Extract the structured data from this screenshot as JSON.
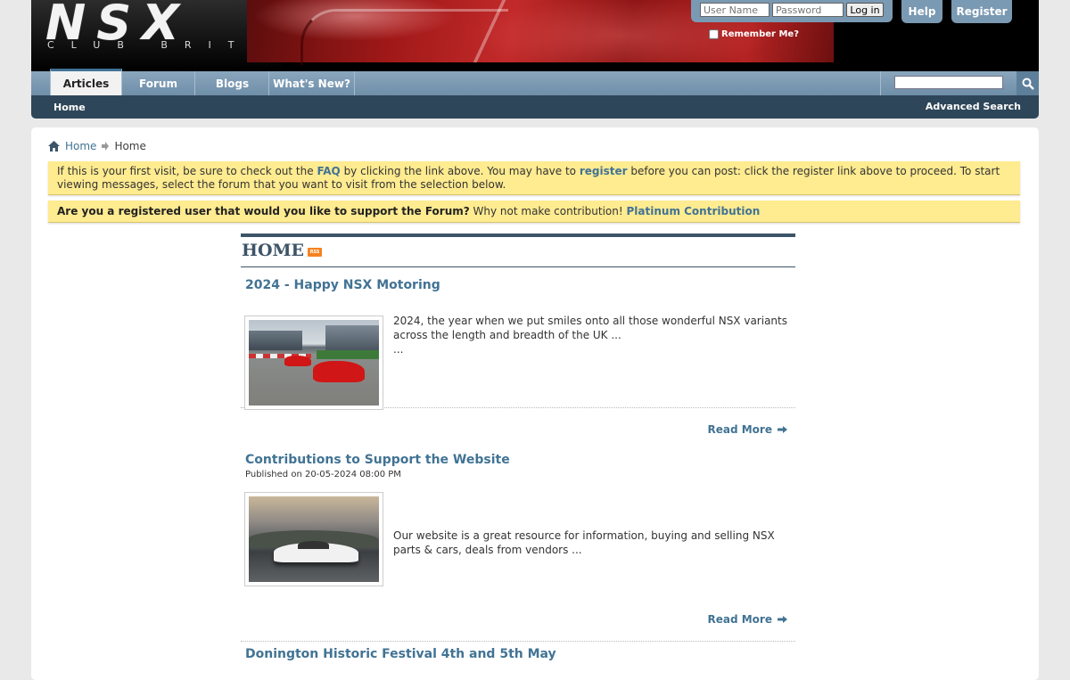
{
  "header": {
    "logo_main": "NSX",
    "logo_sub": "CLUB BRITAIN",
    "login": {
      "username_placeholder": "User Name",
      "password_placeholder": "Password",
      "login_label": "Log in",
      "remember_label": "Remember Me?"
    },
    "help_label": "Help",
    "register_label": "Register"
  },
  "nav": {
    "tabs": [
      {
        "label": "Articles",
        "active": true
      },
      {
        "label": "Forum"
      },
      {
        "label": "Blogs"
      },
      {
        "label": "What's New?"
      }
    ],
    "search_icon": "magnifier-icon"
  },
  "subnav": {
    "home": "Home",
    "advanced_search": "Advanced Search"
  },
  "breadcrumb": {
    "home_link": "Home",
    "current": "Home"
  },
  "notices": {
    "first_visit": {
      "part1": "If this is your first visit, be sure to check out the ",
      "faq": "FAQ",
      "part2": " by clicking the link above. You may have to ",
      "register": "register",
      "part3": " before you can post: click the register link above to proceed. To start viewing messages, select the forum that you want to visit from the selection below."
    },
    "support": {
      "question": "Are you a registered user that would you like to support the Forum?",
      "text": " Why not make contribution! ",
      "link": "Platinum Contribution"
    }
  },
  "home": {
    "title": "HOME",
    "rss_label": "RSS",
    "read_more": "Read More",
    "articles": [
      {
        "title": "2024 - Happy NSX Motoring",
        "meta": "",
        "text_line1": "2024, the year when we put smiles onto all those wonderful NSX variants across the length and breadth of the UK ...",
        "text_line2": "..."
      },
      {
        "title": "Contributions to Support the Website",
        "meta": "Published on 20-05-2024 08:00 PM",
        "text_line1": "Our website is a great resource for information, buying and selling NSX parts & cars, deals from vendors ...",
        "text_line2": ""
      },
      {
        "title": "Donington Historic Festival 4th and 5th May"
      }
    ]
  },
  "colors": {
    "link": "#417394",
    "nav_bar": "#7a99b2",
    "sub_nav": "#2e4659",
    "notice_bg": "#ffeb90"
  }
}
